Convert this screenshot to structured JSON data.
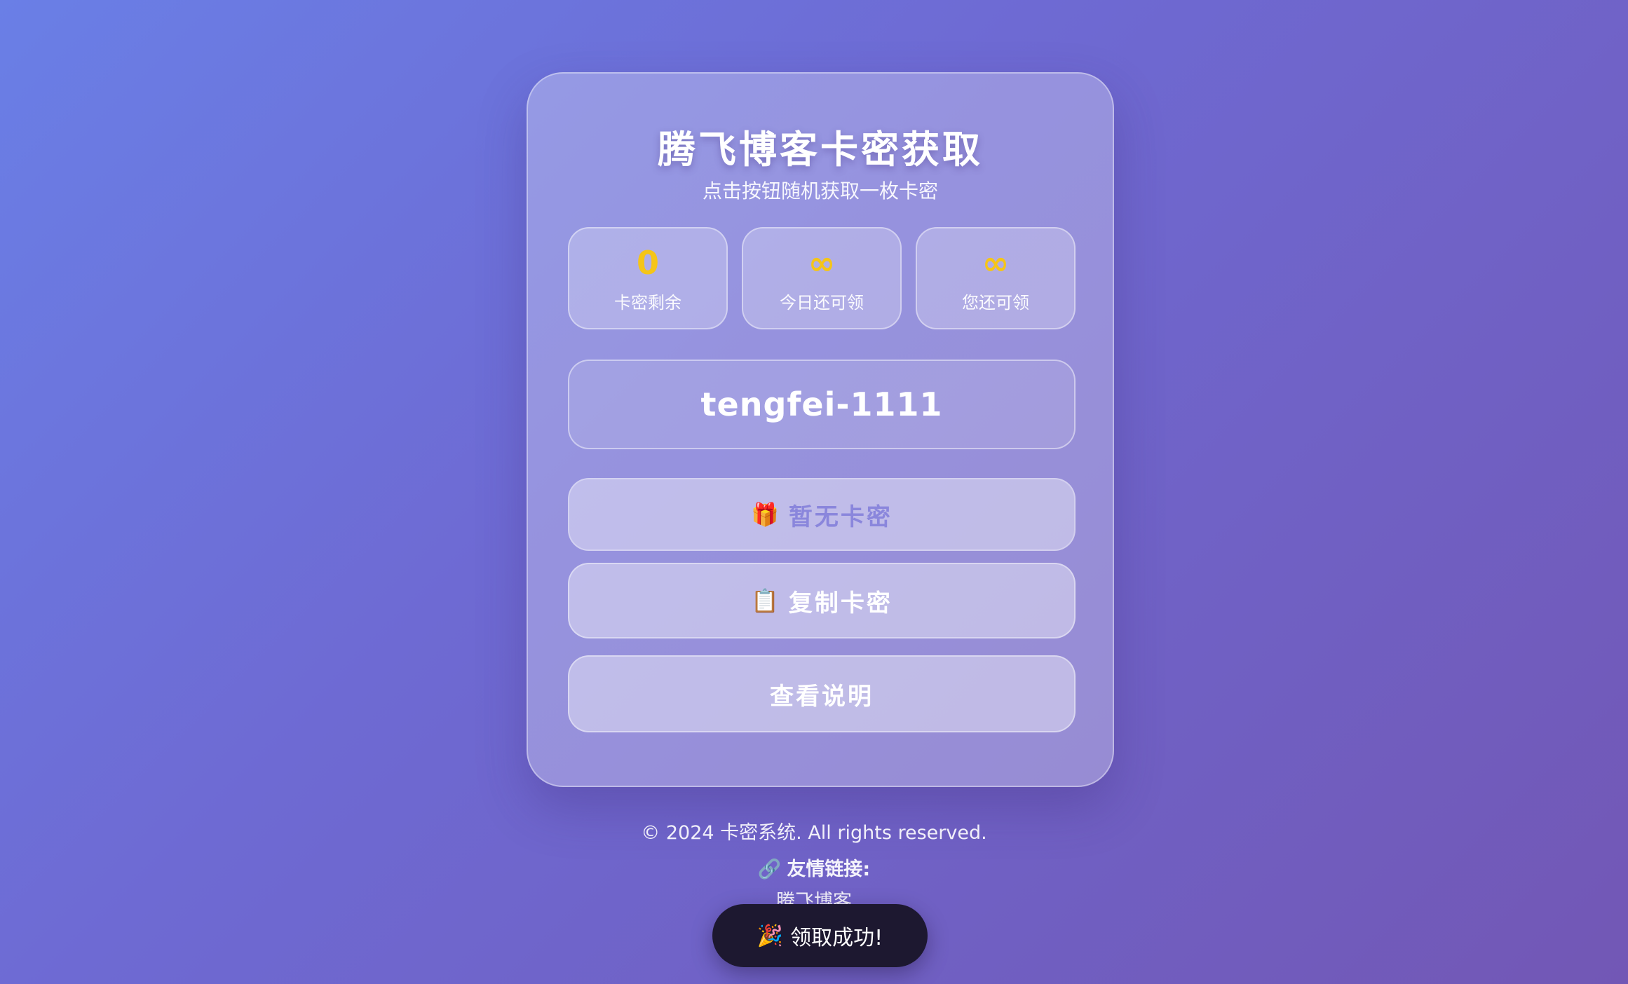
{
  "header": {
    "title": "腾飞博客卡密获取",
    "subtitle": "点击按钮随机获取一枚卡密"
  },
  "stats": [
    {
      "value": "0",
      "label": "卡密剩余"
    },
    {
      "value": "∞",
      "label": "今日还可领"
    },
    {
      "value": "∞",
      "label": "您还可领"
    }
  ],
  "code": {
    "value": "tengfei-1111"
  },
  "buttons": {
    "get": {
      "icon": "🎁",
      "icon_name": "gift-icon",
      "label": "暂无卡密"
    },
    "copy": {
      "icon": "📋",
      "icon_name": "clipboard-icon",
      "label": "复制卡密"
    },
    "help": {
      "label": "查看说明"
    }
  },
  "footer": {
    "copyright": "© 2024 卡密系统. All rights reserved.",
    "links_icon": "🔗",
    "links_icon_name": "link-icon",
    "links_title": "友情链接:",
    "link": "腾飞博客"
  },
  "toast": {
    "icon": "🎉",
    "icon_name": "party-popper-icon",
    "message": "领取成功!"
  },
  "colors": {
    "accent_yellow": "#f5c518",
    "disabled_button_text": "#8a86dc",
    "toast_bg": "#1d1830"
  }
}
